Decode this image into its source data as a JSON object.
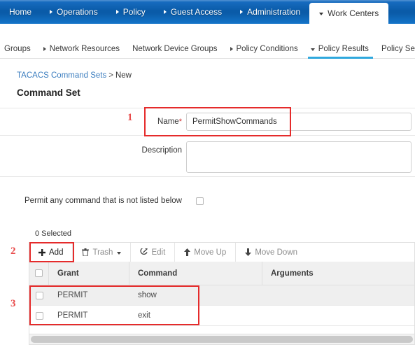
{
  "topnav": {
    "items": [
      {
        "label": "Home",
        "icon": "none",
        "active": false
      },
      {
        "label": "Operations",
        "icon": "caret-right-icon",
        "active": false
      },
      {
        "label": "Policy",
        "icon": "caret-right-icon",
        "active": false
      },
      {
        "label": "Guest Access",
        "icon": "caret-right-icon",
        "active": false
      },
      {
        "label": "Administration",
        "icon": "caret-right-icon",
        "active": false
      },
      {
        "label": "Work Centers",
        "icon": "caret-down-icon",
        "active": true
      }
    ],
    "background_color": "#0a5ba8",
    "active_tab_color": "#ffffff"
  },
  "subnav": {
    "items": [
      {
        "label": "Groups",
        "icon": "none",
        "active": false
      },
      {
        "label": "Network Resources",
        "icon": "caret-right-icon",
        "active": false
      },
      {
        "label": "Network Device Groups",
        "icon": "none",
        "active": false
      },
      {
        "label": "Policy Conditions",
        "icon": "caret-right-icon",
        "active": false
      },
      {
        "label": "Policy Results",
        "icon": "caret-down-icon",
        "active": true
      },
      {
        "label": "Policy Sets",
        "icon": "none",
        "active": false
      }
    ],
    "active_underline_color": "#2fa8dd"
  },
  "breadcrumb": {
    "link": "TACACS Command Sets",
    "separator": ">",
    "current": "New"
  },
  "page": {
    "title": "Command Set"
  },
  "form": {
    "name": {
      "label": "Name",
      "required_marker": "*",
      "value": "PermitShowCommands",
      "placeholder": ""
    },
    "description": {
      "label": "Description",
      "value": "",
      "placeholder": ""
    },
    "permit_any": {
      "label": "Permit any command that is not listed below",
      "checked": false
    }
  },
  "table_section": {
    "selected_count_text": "0 Selected",
    "toolbar": [
      {
        "label": "Add",
        "icon": "plus-icon",
        "enabled": true,
        "has_dropdown": false
      },
      {
        "label": "Trash",
        "icon": "trash-icon",
        "enabled": false,
        "has_dropdown": true
      },
      {
        "label": "Edit",
        "icon": "edit-icon",
        "enabled": false,
        "has_dropdown": false
      },
      {
        "label": "Move Up",
        "icon": "arrow-up-icon",
        "enabled": false,
        "has_dropdown": false
      },
      {
        "label": "Move Down",
        "icon": "arrow-down-icon",
        "enabled": false,
        "has_dropdown": false
      }
    ],
    "columns": [
      "Grant",
      "Command",
      "Arguments"
    ],
    "rows": [
      {
        "grant": "PERMIT",
        "command": "show",
        "arguments": "",
        "checked": false
      },
      {
        "grant": "PERMIT",
        "command": "exit",
        "arguments": "",
        "checked": false
      }
    ]
  },
  "annotations": {
    "color": "#e52b2b",
    "markers": [
      {
        "number": "1",
        "target": "name-field"
      },
      {
        "number": "2",
        "target": "add-button"
      },
      {
        "number": "3",
        "target": "command-rows"
      }
    ]
  }
}
